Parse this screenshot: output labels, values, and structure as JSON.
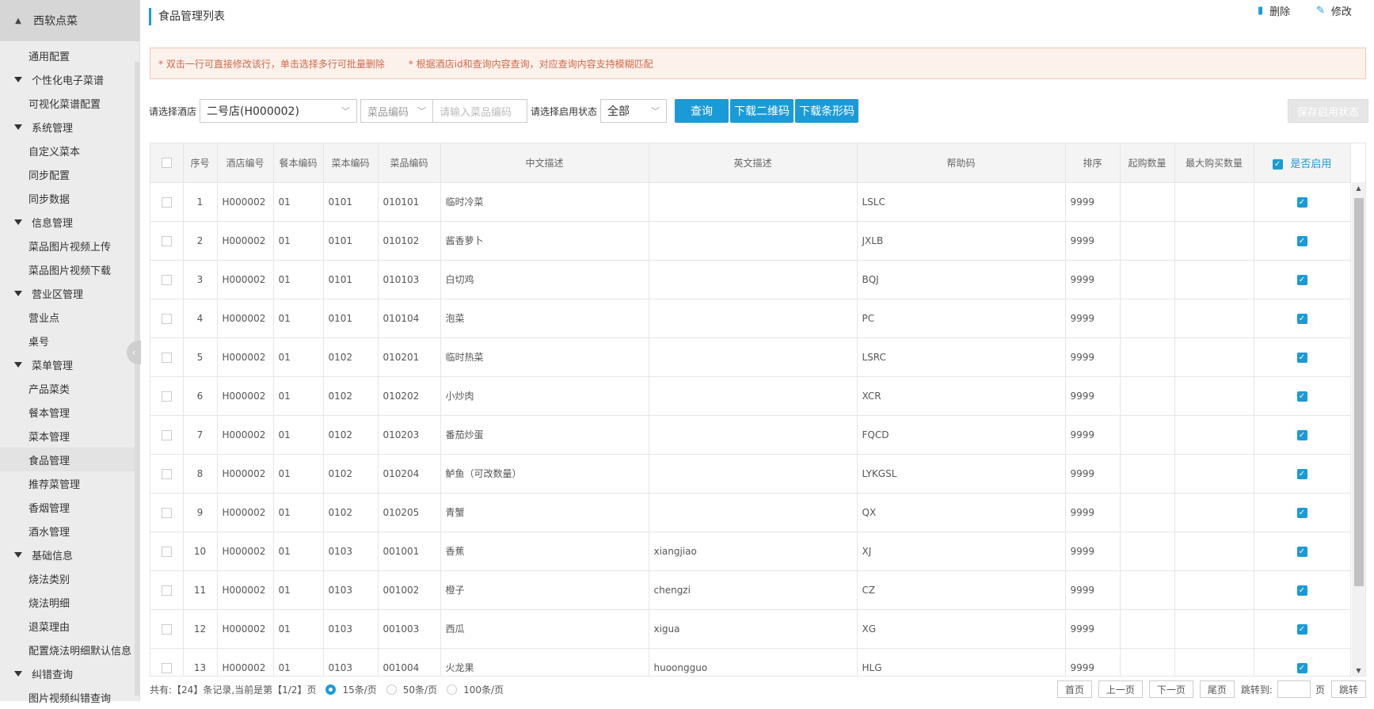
{
  "sidebar": {
    "brand": "西软点菜",
    "brand_icon": "eject-icon",
    "items": [
      {
        "label": "通用配置",
        "type": "sub"
      },
      {
        "label": "个性化电子菜谱",
        "type": "group"
      },
      {
        "label": "可视化菜谱配置",
        "type": "sub"
      },
      {
        "label": "系统管理",
        "type": "group"
      },
      {
        "label": "自定义菜本",
        "type": "sub"
      },
      {
        "label": "同步配置",
        "type": "sub"
      },
      {
        "label": "同步数据",
        "type": "sub"
      },
      {
        "label": "信息管理",
        "type": "group"
      },
      {
        "label": "菜品图片视频上传",
        "type": "sub"
      },
      {
        "label": "菜品图片视频下载",
        "type": "sub"
      },
      {
        "label": "营业区管理",
        "type": "group"
      },
      {
        "label": "营业点",
        "type": "sub"
      },
      {
        "label": "桌号",
        "type": "sub"
      },
      {
        "label": "菜单管理",
        "type": "group"
      },
      {
        "label": "产品菜类",
        "type": "sub"
      },
      {
        "label": "餐本管理",
        "type": "sub"
      },
      {
        "label": "菜本管理",
        "type": "sub"
      },
      {
        "label": "食品管理",
        "type": "sub",
        "active": true
      },
      {
        "label": "推荐菜管理",
        "type": "sub"
      },
      {
        "label": "香烟管理",
        "type": "sub"
      },
      {
        "label": "酒水管理",
        "type": "sub"
      },
      {
        "label": "基础信息",
        "type": "group"
      },
      {
        "label": "烧法类别",
        "type": "sub"
      },
      {
        "label": "烧法明细",
        "type": "sub"
      },
      {
        "label": "退菜理由",
        "type": "sub"
      },
      {
        "label": "配置烧法明细默认信息",
        "type": "sub"
      },
      {
        "label": "纠错查询",
        "type": "group"
      },
      {
        "label": "图片视频纠错查询",
        "type": "sub"
      }
    ]
  },
  "header": {
    "title": "食品管理列表",
    "delete_label": "删除",
    "edit_label": "修改"
  },
  "notice": {
    "tip1": "* 双击一行可直接修改该行，单击选择多行可批量删除",
    "tip2": "* 根据酒店id和查询内容查询，对应查询内容支持模糊匹配"
  },
  "filters": {
    "hotel_label": "请选择酒店",
    "hotel_value": "二号店(H000002)",
    "code_type_value": "菜品编码",
    "code_placeholder": "请输入菜品编码",
    "status_label": "请选择启用状态",
    "status_value": "全部",
    "query_label": "查询",
    "qr_label": "下载二维码",
    "barcode_label": "下载条形码",
    "save_label": "保存启用状态"
  },
  "table": {
    "headers": [
      "序号",
      "酒店编号",
      "餐本编码",
      "菜本编码",
      "菜品编码",
      "中文描述",
      "英文描述",
      "帮助码",
      "排序",
      "起购数量",
      "最大购买数量",
      "是否启用"
    ],
    "rows": [
      [
        "1",
        "H000002",
        "01",
        "0101",
        "010101",
        "临时冷菜",
        "",
        "LSLC",
        "9999",
        "",
        ""
      ],
      [
        "2",
        "H000002",
        "01",
        "0101",
        "010102",
        "酱香萝卜",
        "",
        "JXLB",
        "9999",
        "",
        ""
      ],
      [
        "3",
        "H000002",
        "01",
        "0101",
        "010103",
        "白切鸡",
        "",
        "BQJ",
        "9999",
        "",
        ""
      ],
      [
        "4",
        "H000002",
        "01",
        "0101",
        "010104",
        "泡菜",
        "",
        "PC",
        "9999",
        "",
        ""
      ],
      [
        "5",
        "H000002",
        "01",
        "0102",
        "010201",
        "临时热菜",
        "",
        "LSRC",
        "9999",
        "",
        ""
      ],
      [
        "6",
        "H000002",
        "01",
        "0102",
        "010202",
        "小炒肉",
        "",
        "XCR",
        "9999",
        "",
        ""
      ],
      [
        "7",
        "H000002",
        "01",
        "0102",
        "010203",
        "番茄炒蛋",
        "",
        "FQCD",
        "9999",
        "",
        ""
      ],
      [
        "8",
        "H000002",
        "01",
        "0102",
        "010204",
        "鲈鱼（可改数量）",
        "",
        "LYKGSL",
        "9999",
        "",
        ""
      ],
      [
        "9",
        "H000002",
        "01",
        "0102",
        "010205",
        "青蟹",
        "",
        "QX",
        "9999",
        "",
        ""
      ],
      [
        "10",
        "H000002",
        "01",
        "0103",
        "001001",
        "香蕉",
        "xiangjiao",
        "XJ",
        "9999",
        "",
        ""
      ],
      [
        "11",
        "H000002",
        "01",
        "0103",
        "001002",
        "橙子",
        "chengzi",
        "CZ",
        "9999",
        "",
        ""
      ],
      [
        "12",
        "H000002",
        "01",
        "0103",
        "001003",
        "西瓜",
        "xigua",
        "XG",
        "9999",
        "",
        ""
      ],
      [
        "13",
        "H000002",
        "01",
        "0103",
        "001004",
        "火龙果",
        "huoongguo",
        "HLG",
        "9999",
        "",
        ""
      ]
    ]
  },
  "footer": {
    "summary": "共有:【24】条记录,当前是第【1/2】页",
    "opt15": "15条/页",
    "opt50": "50条/页",
    "opt100": "100条/页",
    "first": "首页",
    "prev": "上一页",
    "next": "下一页",
    "last": "尾页",
    "jump_label": "跳转到:",
    "page_unit": "页",
    "jump_btn": "跳转"
  },
  "colors": {
    "accent": "#1a9bd7",
    "notice_text": "#d06a4a",
    "notice_bg": "#fdf1ec"
  }
}
